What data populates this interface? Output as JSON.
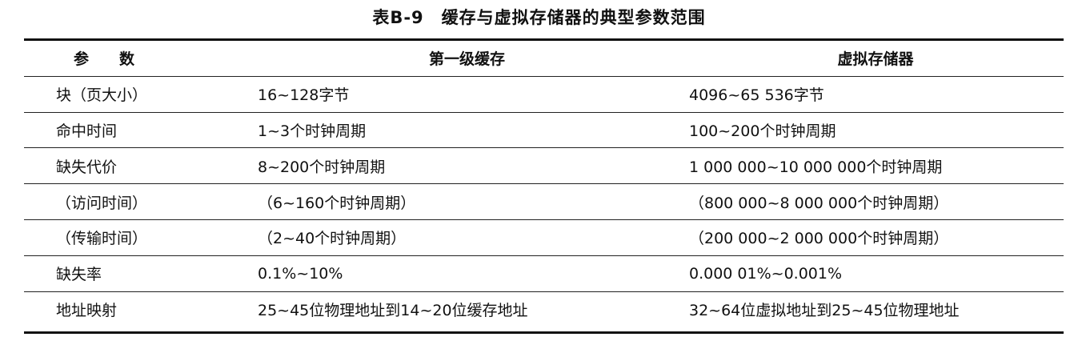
{
  "caption": {
    "number": "表B-9",
    "title": "缓存与虚拟存储器的典型参数范围"
  },
  "table": {
    "headers": [
      "参　　数",
      "第一级缓存",
      "虚拟存储器"
    ],
    "rows": [
      [
        "块（页大小）",
        "16~128字节",
        "4096~65 536字节"
      ],
      [
        "命中时间",
        "1~3个时钟周期",
        "100~200个时钟周期"
      ],
      [
        "缺失代价",
        "8~200个时钟周期",
        "1 000 000~10 000 000个时钟周期"
      ],
      [
        "（访问时间）",
        "（6~160个时钟周期）",
        "（800 000~8 000 000个时钟周期）"
      ],
      [
        "（传输时间）",
        "（2~40个时钟周期）",
        "（200 000~2 000 000个时钟周期）"
      ],
      [
        "缺失率",
        "0.1%~10%",
        "0.000 01%~0.001%"
      ],
      [
        "地址映射",
        "25~45位物理地址到14~20位缓存地址",
        "32~64位虚拟地址到25~45位物理地址"
      ]
    ]
  }
}
